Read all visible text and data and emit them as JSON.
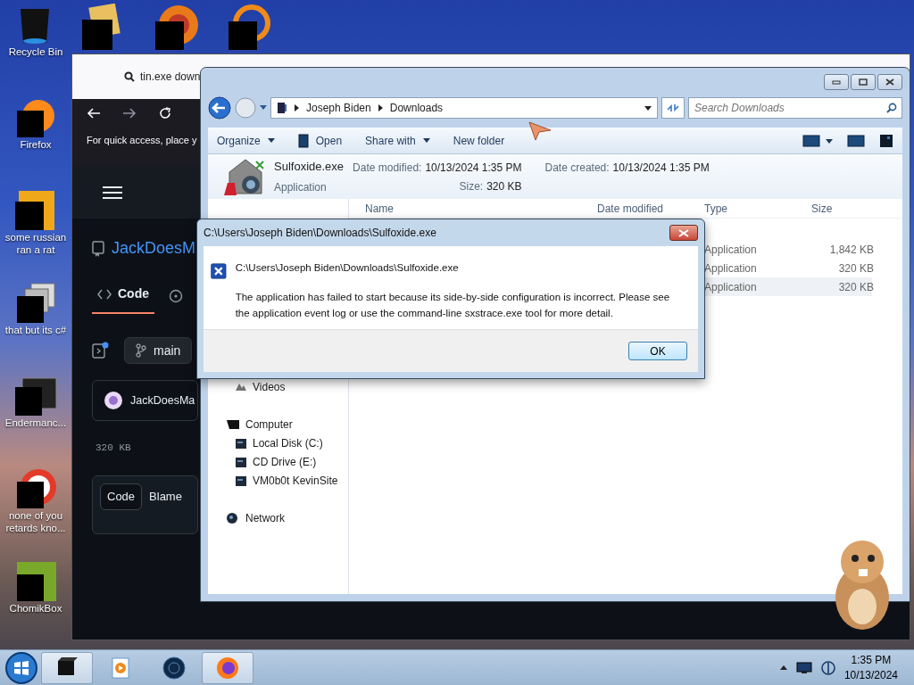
{
  "desktop_icons": [
    {
      "label": "Recycle Bin"
    },
    {
      "label": "Firefox"
    },
    {
      "label": "some russian ran a rat"
    },
    {
      "label": "that but its c#"
    },
    {
      "label": "Endermanc..."
    },
    {
      "label": "none of you retards kno..."
    },
    {
      "label": "ChomikBox"
    }
  ],
  "browser": {
    "search_text": "tin.exe down",
    "bookmarks_hint": "For quick access, place y",
    "repo_name": "JackDoesM",
    "repo_tabs": [
      {
        "label": "Code",
        "selected": true
      }
    ],
    "branch": "main",
    "commit_author": "JackDoesMa",
    "file_size": "320 KB",
    "view_toggle": [
      {
        "label": "Code",
        "selected": true
      },
      {
        "label": "Blame",
        "selected": false
      }
    ]
  },
  "explorer": {
    "breadcrumbs": [
      "Joseph Biden",
      "Downloads"
    ],
    "search": {
      "placeholder": "Search Downloads"
    },
    "toolbar": [
      {
        "label": "Organize",
        "kind": "menu"
      },
      {
        "label": "Open",
        "kind": "action"
      },
      {
        "label": "Share with",
        "kind": "menu"
      },
      {
        "label": "New folder",
        "kind": "plain"
      }
    ],
    "details": {
      "file_name": "Sulfoxide.exe",
      "file_type": "Application",
      "fields": [
        {
          "label": "Date modified:",
          "value": "10/13/2024 1:35 PM"
        },
        {
          "label": "Size:",
          "value": "320 KB"
        },
        {
          "label": "Date created:",
          "value": "10/13/2024 1:35 PM"
        }
      ]
    },
    "columns": [
      "Name",
      "Date modified",
      "Type",
      "Size"
    ],
    "rows": [
      {
        "type": "Application",
        "size": "1,842 KB",
        "selected": false
      },
      {
        "type": "Application",
        "size": "320 KB",
        "selected": false
      },
      {
        "type": "Application",
        "size": "320 KB",
        "selected": true
      }
    ],
    "nav_pane": {
      "library_items": [
        {
          "label": "Videos"
        }
      ],
      "tree": [
        {
          "label": "Computer",
          "children": [
            {
              "label": "Local Disk (C:)"
            },
            {
              "label": "CD Drive (E:)"
            },
            {
              "label": "VM0b0t KevinSite"
            }
          ]
        },
        {
          "label": "Network"
        }
      ]
    }
  },
  "dialog": {
    "title": "C:\\Users\\Joseph Biden\\Downloads\\Sulfoxide.exe",
    "heading": "C:\\Users\\Joseph Biden\\Downloads\\Sulfoxide.exe",
    "message": "The application has failed to start because its side-by-side configuration is incorrect. Please see the application event log or use the command-line sxstrace.exe tool for more detail.",
    "button": "OK"
  },
  "taskbar": {
    "pinned": [
      {
        "active": true
      },
      {
        "active": false
      },
      {
        "active": false
      },
      {
        "active": true
      }
    ],
    "time": "1:35 PM",
    "date": "10/13/2024"
  }
}
